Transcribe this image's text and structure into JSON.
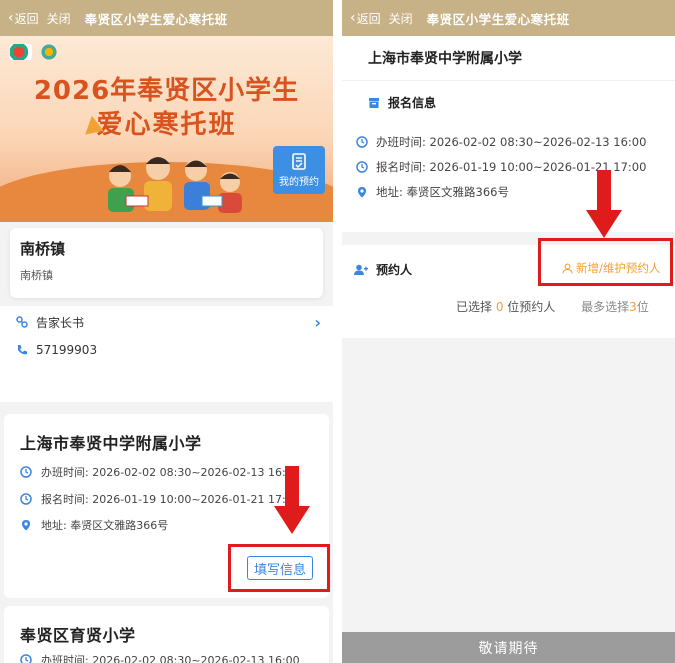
{
  "left": {
    "nav": {
      "back_label": "返回",
      "close_label": "关闭",
      "title": "奉贤区小学生爱心寒托班"
    },
    "banner": {
      "title_line1": "2026年奉贤区小学生",
      "title_line2": "爱心寒托班",
      "my_appointment_label": "我的预约"
    },
    "town": {
      "name": "南桥镇",
      "subtitle": "南桥镇"
    },
    "parent_letter_label": "告家长书",
    "phone": "57199903",
    "schools": [
      {
        "name": "上海市奉贤中学附属小学",
        "class_time": "办班时间: 2026-02-02 08:30~2026-02-13 16:00",
        "reg_time": "报名时间: 2026-01-19 10:00~2026-01-21 17:00",
        "address": "地址: 奉贤区文雅路366号",
        "fill_button": "填写信息"
      },
      {
        "name": "奉贤区育贤小学",
        "class_time": "办班时间: 2026-02-02 08:30~2026-02-13 16:00"
      }
    ]
  },
  "right": {
    "nav": {
      "back_label": "返回",
      "close_label": "关闭",
      "title": "奉贤区小学生爱心寒托班"
    },
    "school_name": "上海市奉贤中学附属小学",
    "reg_section_title": "报名信息",
    "class_time": "办班时间: 2026-02-02 08:30~2026-02-13 16:00",
    "reg_time": "报名时间: 2026-01-19 10:00~2026-01-21 17:00",
    "address": "地址: 奉贤区文雅路366号",
    "booker_title": "预约人",
    "add_booker_label": "新增/维护预约人",
    "selected_prefix": "已选择 ",
    "selected_count": "0",
    "selected_suffix": " 位预约人",
    "max_prefix": "最多选择",
    "max_count": "3",
    "max_suffix": "位",
    "bottom_label": "敬请期待"
  },
  "colors": {
    "nav_bg": "#c7b288",
    "accent_blue": "#3b86e0",
    "accent_orange": "#f2a233",
    "highlight_red": "#e01b1b",
    "banner_title": "#d9531e"
  }
}
